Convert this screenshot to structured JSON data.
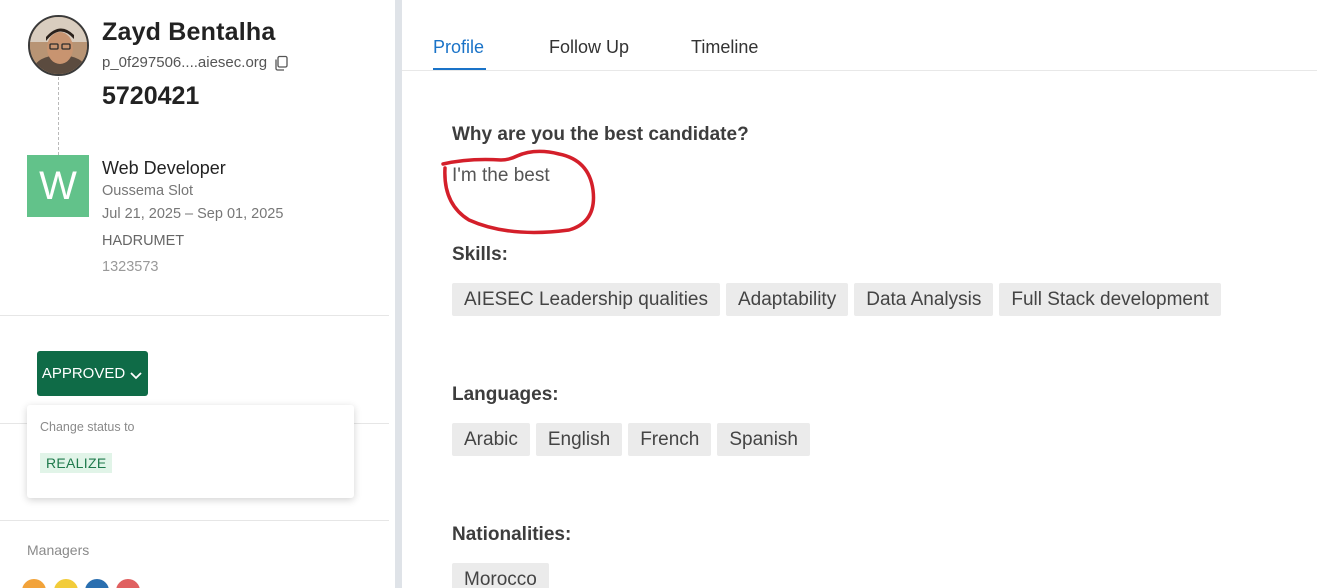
{
  "profile": {
    "name": "Zayd Bentalha",
    "email": "p_0f297506....aiesec.org",
    "id": "5720421"
  },
  "opportunity": {
    "logo_letter": "W",
    "title": "Web Developer",
    "company": "Oussema Slot",
    "dates": "Jul 21, 2025 – Sep 01, 2025",
    "entity": "HADRUMET",
    "code": "1323573"
  },
  "status": {
    "current": "APPROVED",
    "dropdown_label": "Change status to",
    "options": [
      "REALIZE"
    ]
  },
  "managers": {
    "label": "Managers",
    "avatar_colors": [
      "#f2a33a",
      "#f2cc3a",
      "#2a6fb0",
      "#e06060"
    ]
  },
  "tabs": [
    "Profile",
    "Follow Up",
    "Timeline"
  ],
  "active_tab": "Profile",
  "sections": {
    "best_candidate": {
      "title": "Why are you the best candidate?",
      "answer": "I'm the best"
    },
    "skills": {
      "title": "Skills:",
      "items": [
        "AIESEC Leadership qualities",
        "Adaptability",
        "Data Analysis",
        "Full Stack development"
      ]
    },
    "languages": {
      "title": "Languages:",
      "items": [
        "Arabic",
        "English",
        "French",
        "Spanish"
      ]
    },
    "nationalities": {
      "title": "Nationalities:",
      "items": [
        "Morocco"
      ]
    }
  },
  "colors": {
    "accent_blue": "#1a73c8",
    "status_green": "#0f6b47",
    "logo_green": "#62c28a",
    "annotation_red": "#d41f2a"
  },
  "icons": [
    "copy-icon",
    "chevron-down-icon"
  ]
}
